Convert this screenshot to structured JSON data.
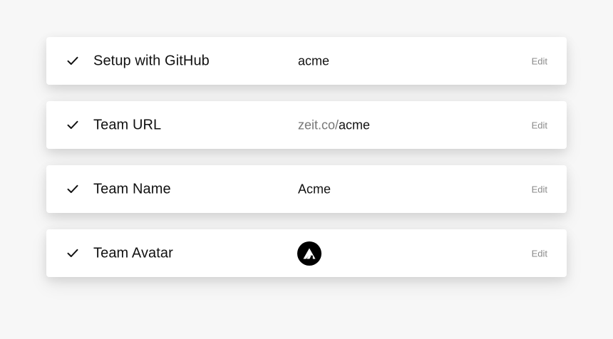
{
  "steps": [
    {
      "label": "Setup with GitHub",
      "value": "acme",
      "edit_label": "Edit",
      "icon": "check-icon"
    },
    {
      "label": "Team URL",
      "value_prefix": "zeit.co/",
      "value": "acme",
      "edit_label": "Edit",
      "icon": "check-icon"
    },
    {
      "label": "Team Name",
      "value": "Acme",
      "edit_label": "Edit",
      "icon": "check-icon"
    },
    {
      "label": "Team Avatar",
      "avatar_icon": "team-avatar-logo-icon",
      "edit_label": "Edit",
      "icon": "check-icon"
    }
  ],
  "colors": {
    "background": "#f7f7f7",
    "card": "#ffffff",
    "text": "#111111",
    "muted": "#777777",
    "edit": "#8a8a8a",
    "avatar": "#000000"
  }
}
